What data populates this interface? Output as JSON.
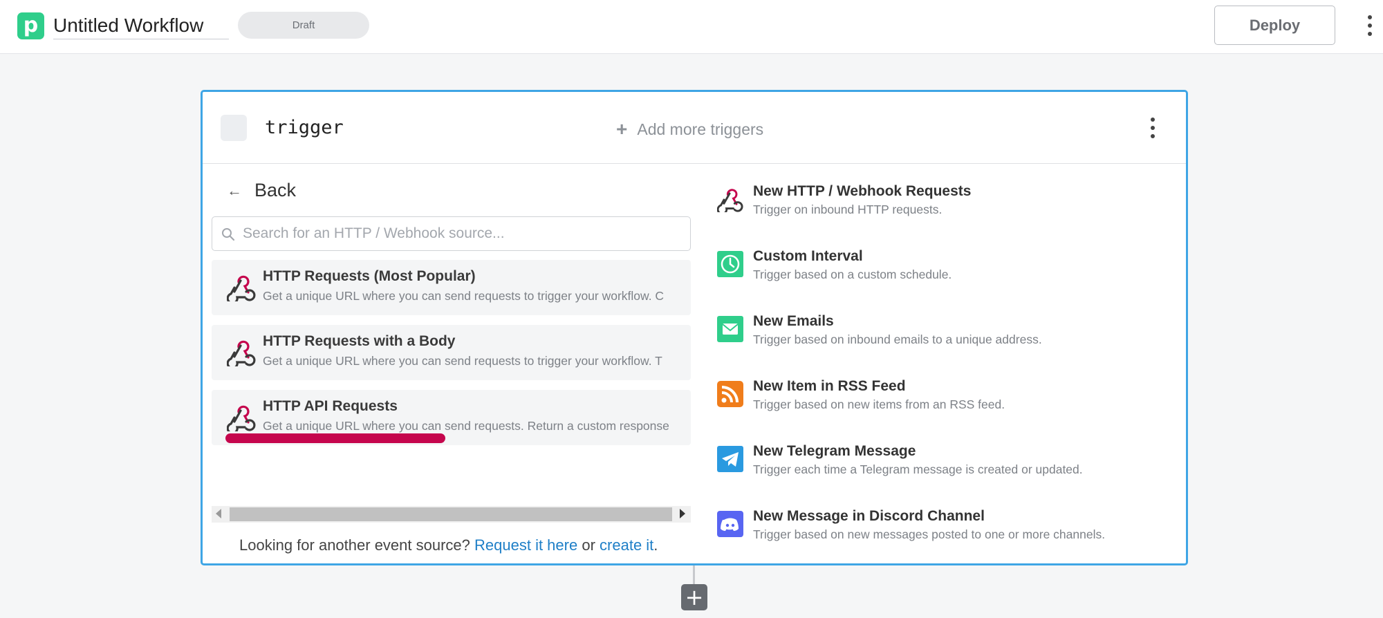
{
  "header": {
    "logo_letter": "p",
    "workflow_title": "Untitled Workflow",
    "status": "Draft",
    "deploy_label": "Deploy"
  },
  "trigger_card": {
    "name": "trigger",
    "add_more_label": "Add more triggers",
    "back_label": "Back",
    "search": {
      "placeholder": "Search for an HTTP / Webhook source...",
      "value": ""
    },
    "sources": [
      {
        "name": "HTTP Requests (Most Popular)",
        "description": "Get a unique URL where you can send requests to trigger your workflow. C",
        "icon": "webhook-icon"
      },
      {
        "name": "HTTP Requests with a Body",
        "description": "Get a unique URL where you can send requests to trigger your workflow. T",
        "icon": "webhook-icon"
      },
      {
        "name": "HTTP API Requests",
        "description": "Get a unique URL where you can send requests. Return a custom response",
        "icon": "webhook-icon"
      }
    ],
    "footer": {
      "text": "Looking for another event source?",
      "link1": "Request it here",
      "middle": "or",
      "link2": "create it",
      "end": "."
    },
    "apps": [
      {
        "name": "New HTTP / Webhook Requests",
        "description": "Trigger on inbound HTTP requests.",
        "icon": "webhook-icon"
      },
      {
        "name": "Custom Interval",
        "description": "Trigger based on a custom schedule.",
        "icon": "clock-icon"
      },
      {
        "name": "New Emails",
        "description": "Trigger based on inbound emails to a unique address.",
        "icon": "email-icon"
      },
      {
        "name": "New Item in RSS Feed",
        "description": "Trigger based on new items from an RSS feed.",
        "icon": "rss-icon"
      },
      {
        "name": "New Telegram Message",
        "description": "Trigger each time a Telegram message is created or updated.",
        "icon": "telegram-icon"
      },
      {
        "name": "New Message in Discord Channel",
        "description": "Trigger based on new messages posted to one or more channels.",
        "icon": "discord-icon"
      }
    ]
  },
  "add_step_label": "+",
  "colors": {
    "brand": "#2fce8b",
    "card_border": "#3ea5e5",
    "link": "#1f7fc7",
    "highlight": "#c5064d"
  }
}
